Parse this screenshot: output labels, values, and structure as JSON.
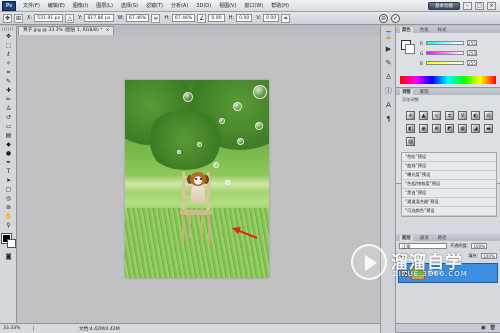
{
  "app": {
    "logo_text": "Ps"
  },
  "menubar": {
    "items": [
      "文件(F)",
      "编辑(E)",
      "图像(I)",
      "图层(L)",
      "选择(S)",
      "滤镜(T)",
      "分析(A)",
      "3D(D)",
      "视图(V)",
      "窗口(W)",
      "帮助(H)"
    ],
    "workspace_button": "基本功能",
    "window_controls": [
      "–",
      "□",
      "×"
    ]
  },
  "options_bar": {
    "x_label": "X:",
    "x_value": "531.91 px",
    "y_label": "Y:",
    "y_value": "817.86 px",
    "w_label": "W:",
    "w_value": "67.46%",
    "h_label": "H:",
    "h_value": "67.46%",
    "angle_value": "0.00",
    "hskew_label": "H:",
    "hskew_value": "0.00",
    "vskew_label": "V:",
    "vskew_value": "0.00",
    "cancel_glyph": "⊘",
    "commit_glyph": "✓"
  },
  "document": {
    "tab_title": "凳子.jpg @ 33.3% (图层 1, RGB/8) *",
    "tab_close": "×"
  },
  "statusbar": {
    "zoom": "33.33%",
    "doc_info": "文档:4.42M/4.42M"
  },
  "color_panel": {
    "tabs": [
      "颜色",
      "色板",
      "样式"
    ],
    "sliders": [
      {
        "label": "R",
        "value": "255",
        "gradient": "#00ffff"
      },
      {
        "label": "G",
        "value": "255",
        "gradient": "#ff00ff"
      },
      {
        "label": "B",
        "value": "255",
        "gradient": "#ffff00"
      }
    ]
  },
  "adjust_panel": {
    "tabs": [
      "调整",
      "蒙版"
    ],
    "title": "添加调整",
    "presets": [
      "“色阶”预设",
      "“曲线”预设",
      "“曝光度”预设",
      "“色相/饱和度”预设",
      "“黑白”预设",
      "“通道混合器”预设",
      "“可选颜色”预设"
    ]
  },
  "layers_panel": {
    "tabs": [
      "图层",
      "通道",
      "路径"
    ],
    "blend_mode": "正常",
    "opacity_label": "不透明度:",
    "opacity_value": "100%",
    "lock_label": "锁定:",
    "fill_label": "填充:",
    "fill_value": "100%",
    "layer_name": "图层 1",
    "eye_glyph": "●"
  },
  "watermark": {
    "title": "溜溜自学",
    "url": "ZIXUE.3D66.COM"
  },
  "colors": {
    "layer_selected": "#3d8ee0",
    "annotation_arrow": "#e02020"
  }
}
